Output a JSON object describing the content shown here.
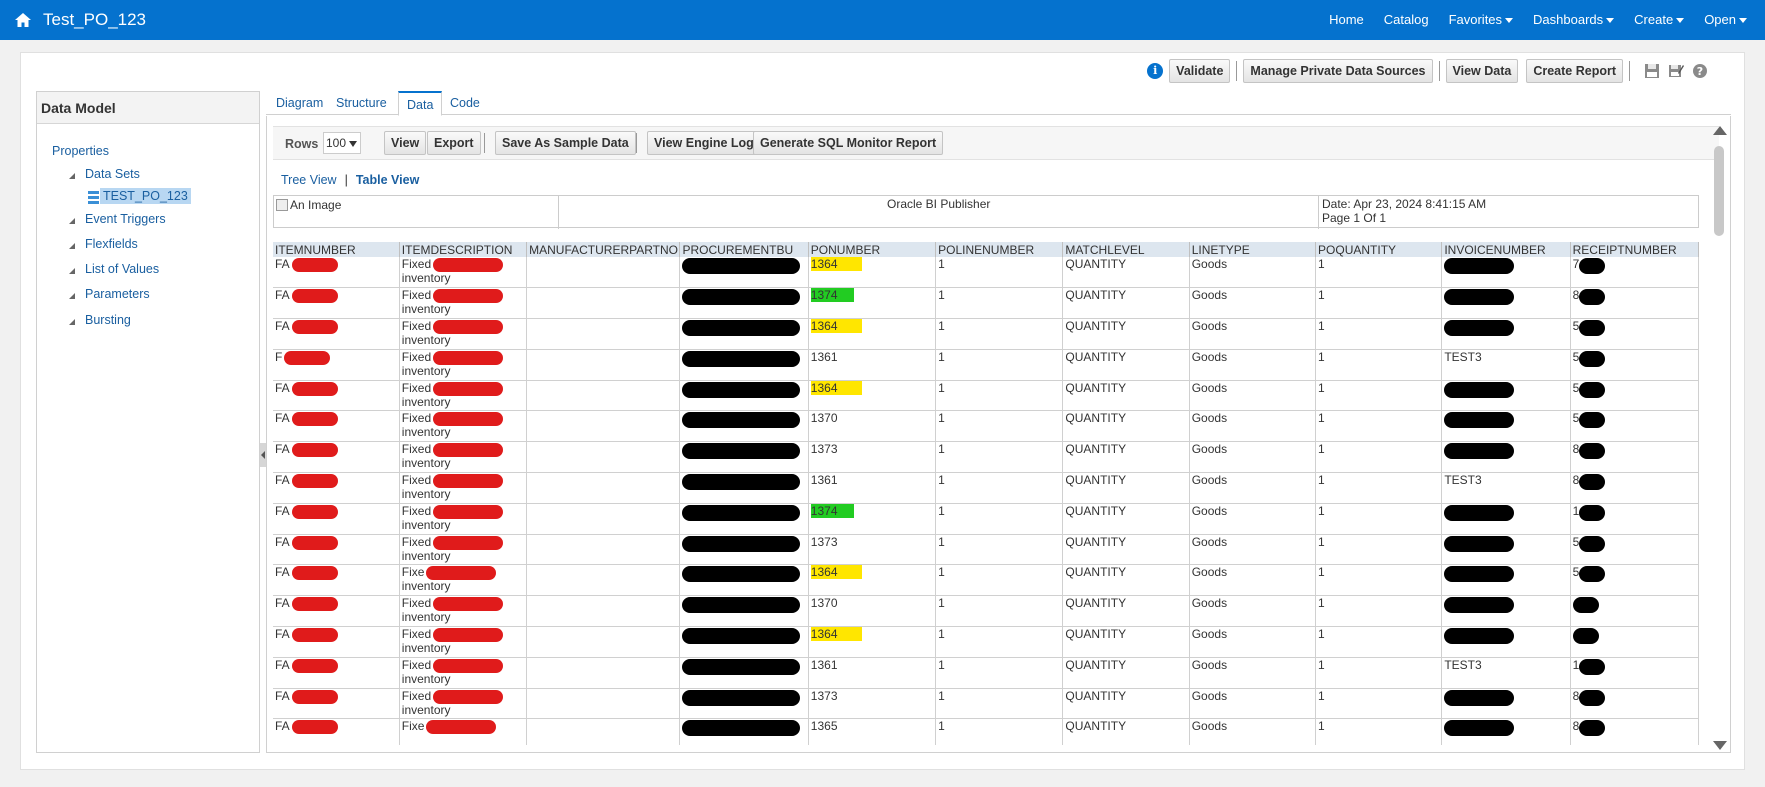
{
  "topbar": {
    "title": "Test_PO_123",
    "nav": [
      {
        "label": "Home",
        "dropdown": false
      },
      {
        "label": "Catalog",
        "dropdown": false
      },
      {
        "label": "Favorites",
        "dropdown": true
      },
      {
        "label": "Dashboards",
        "dropdown": true
      },
      {
        "label": "Create",
        "dropdown": true
      },
      {
        "label": "Open",
        "dropdown": true
      }
    ]
  },
  "toolbar": {
    "validate": "Validate",
    "manage_private": "Manage Private Data Sources",
    "view_data": "View Data",
    "create_report": "Create Report"
  },
  "left_panel": {
    "title": "Data Model",
    "properties": "Properties",
    "data_sets": "Data Sets",
    "dataset_name": "TEST_PO_123",
    "event_triggers": "Event Triggers",
    "flexfields": "Flexfields",
    "list_of_values": "List of Values",
    "parameters": "Parameters",
    "bursting": "Bursting"
  },
  "tabs": {
    "diagram": "Diagram",
    "structure": "Structure",
    "data": "Data",
    "code": "Code"
  },
  "controls": {
    "rows_label": "Rows",
    "rows_value": "100",
    "view": "View",
    "export": "Export",
    "save_sample": "Save As Sample Data",
    "view_engine_log": "View Engine Log",
    "sql_monitor": "Generate SQL Monitor Report"
  },
  "view_links": {
    "tree": "Tree View",
    "table": "Table View"
  },
  "report": {
    "image_alt": "An Image",
    "title": "Oracle BI Publisher",
    "date": "Date: Apr 23, 2024 8:41:15 AM",
    "page": "Page 1 Of 1"
  },
  "columns": [
    "ITEMNUMBER",
    "ITEMDESCRIPTION",
    "MANUFACTURERPARTNO",
    "PROCUREMENTBU",
    "PONUMBER",
    "POLINENUMBER",
    "MATCHLEVEL",
    "LINETYPE",
    "POQUANTITY",
    "INVOICENUMBER",
    "RECEIPTNUMBER"
  ],
  "rows": [
    {
      "item": "FA",
      "desc1": "Fixed",
      "desc2": "inventory",
      "po": "1364",
      "hl": "yellow",
      "line": "1",
      "match": "QUANTITY",
      "type": "Goods",
      "qty": "1",
      "inv": "",
      "rcpt": "7"
    },
    {
      "item": "FA",
      "desc1": "Fixed",
      "desc2": "inventory",
      "po": "1374",
      "hl": "green",
      "line": "1",
      "match": "QUANTITY",
      "type": "Goods",
      "qty": "1",
      "inv": "",
      "rcpt": "8"
    },
    {
      "item": "FA",
      "desc1": "Fixed",
      "desc2": "inventory",
      "po": "1364",
      "hl": "yellow",
      "line": "1",
      "match": "QUANTITY",
      "type": "Goods",
      "qty": "1",
      "inv": "",
      "rcpt": "5"
    },
    {
      "item": "F",
      "desc1": "Fixed",
      "desc2": "inventory",
      "po": "1361",
      "hl": "",
      "line": "1",
      "match": "QUANTITY",
      "type": "Goods",
      "qty": "1",
      "inv": "TEST3",
      "rcpt": "5"
    },
    {
      "item": "FA",
      "desc1": "Fixed",
      "desc2": "inventory",
      "po": "1364",
      "hl": "yellow",
      "line": "1",
      "match": "QUANTITY",
      "type": "Goods",
      "qty": "1",
      "inv": "",
      "rcpt": "5"
    },
    {
      "item": "FA",
      "desc1": "Fixed",
      "desc2": "inventory",
      "po": "1370",
      "hl": "",
      "line": "1",
      "match": "QUANTITY",
      "type": "Goods",
      "qty": "1",
      "inv": "",
      "rcpt": "5"
    },
    {
      "item": "FA",
      "desc1": "Fixed",
      "desc2": "inventory",
      "po": "1373",
      "hl": "",
      "line": "1",
      "match": "QUANTITY",
      "type": "Goods",
      "qty": "1",
      "inv": "",
      "rcpt": "8"
    },
    {
      "item": "FA",
      "desc1": "Fixed",
      "desc2": "inventory",
      "po": "1361",
      "hl": "",
      "line": "1",
      "match": "QUANTITY",
      "type": "Goods",
      "qty": "1",
      "inv": "TEST3",
      "rcpt": "8"
    },
    {
      "item": "FA",
      "desc1": "Fixed",
      "desc2": "inventory",
      "po": "1374",
      "hl": "green",
      "line": "1",
      "match": "QUANTITY",
      "type": "Goods",
      "qty": "1",
      "inv": "",
      "rcpt": "1"
    },
    {
      "item": "FA",
      "desc1": "Fixed",
      "desc2": "inventory",
      "po": "1373",
      "hl": "",
      "line": "1",
      "match": "QUANTITY",
      "type": "Goods",
      "qty": "1",
      "inv": "",
      "rcpt": "5"
    },
    {
      "item": "FA",
      "desc1": "Fixe",
      "desc2": "inventory",
      "po": "1364",
      "hl": "yellow",
      "line": "1",
      "match": "QUANTITY",
      "type": "Goods",
      "qty": "1",
      "inv": "",
      "rcpt": "5"
    },
    {
      "item": "FA",
      "desc1": "Fixed",
      "desc2": "inventory",
      "po": "1370",
      "hl": "",
      "line": "1",
      "match": "QUANTITY",
      "type": "Goods",
      "qty": "1",
      "inv": "",
      "rcpt": ""
    },
    {
      "item": "FA",
      "desc1": "Fixed",
      "desc2": "inventory",
      "po": "1364",
      "hl": "yellow",
      "line": "1",
      "match": "QUANTITY",
      "type": "Goods",
      "qty": "1",
      "inv": "",
      "rcpt": ""
    },
    {
      "item": "FA",
      "desc1": "Fixed",
      "desc2": "inventory",
      "po": "1361",
      "hl": "",
      "line": "1",
      "match": "QUANTITY",
      "type": "Goods",
      "qty": "1",
      "inv": "TEST3",
      "rcpt": "1"
    },
    {
      "item": "FA",
      "desc1": "Fixed",
      "desc2": "inventory",
      "po": "1373",
      "hl": "",
      "line": "1",
      "match": "QUANTITY",
      "type": "Goods",
      "qty": "1",
      "inv": "",
      "rcpt": "8"
    },
    {
      "item": "FA",
      "desc1": "Fixe",
      "desc2": "",
      "po": "1365",
      "hl": "",
      "line": "1",
      "match": "QUANTITY",
      "type": "Goods",
      "qty": "1",
      "inv": "",
      "rcpt": "8"
    }
  ],
  "colors": {
    "brand": "#0572ce",
    "highlight_yellow": "#ffe600",
    "highlight_green": "#22cc22",
    "redaction_red": "#e01b1b",
    "redaction_black": "#000000"
  }
}
